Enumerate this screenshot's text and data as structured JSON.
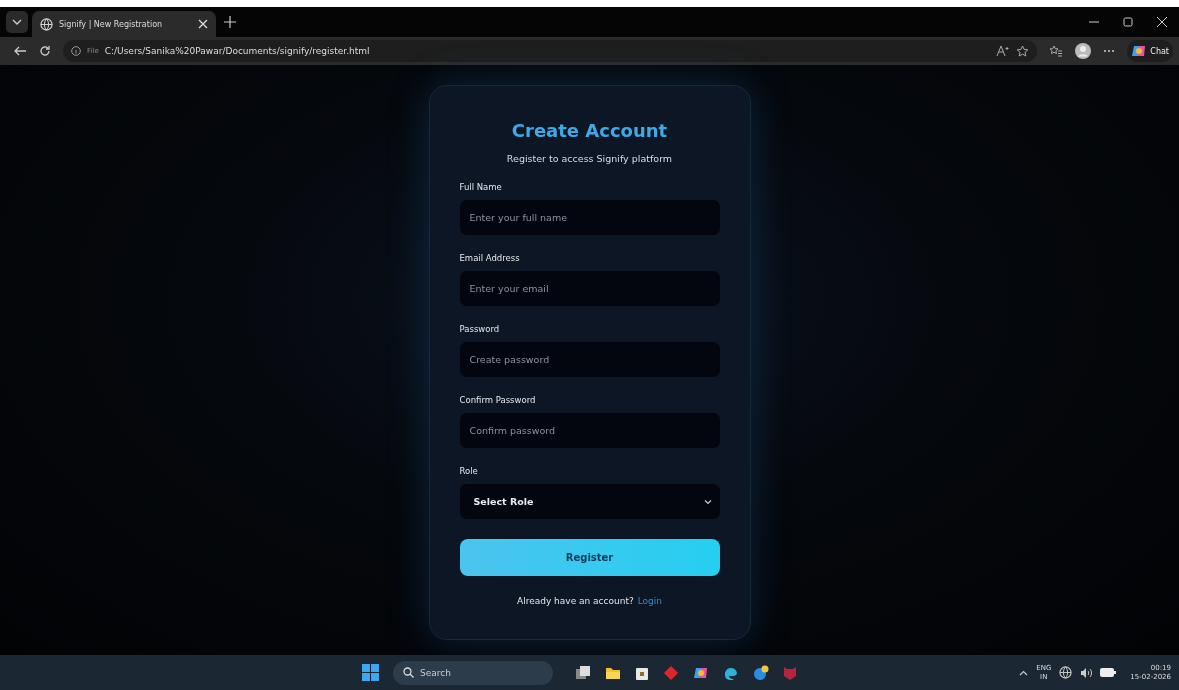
{
  "browser": {
    "tab_title": "Signify | New Registration",
    "url_scheme": "File",
    "url": "C:/Users/Sanika%20Pawar/Documents/signify/register.html",
    "chat_label": "Chat"
  },
  "form": {
    "title": "Create Account",
    "subtitle": "Register to access Signify platform",
    "fields": [
      {
        "kind": "text",
        "label": "Full Name",
        "placeholder": "Enter your full name"
      },
      {
        "kind": "text",
        "label": "Email Address",
        "placeholder": "Enter your email"
      },
      {
        "kind": "password",
        "label": "Password",
        "placeholder": "Create password"
      },
      {
        "kind": "password",
        "label": "Confirm Password",
        "placeholder": "Confirm password"
      },
      {
        "kind": "select",
        "label": "Role",
        "value": "Select Role"
      }
    ],
    "submit": "Register",
    "footer_text": "Already have an account?",
    "footer_link": "Login"
  },
  "taskbar": {
    "search_placeholder": "Search",
    "language": "ENG",
    "region": "IN",
    "time": "00:19",
    "date": "15-02-2026"
  }
}
